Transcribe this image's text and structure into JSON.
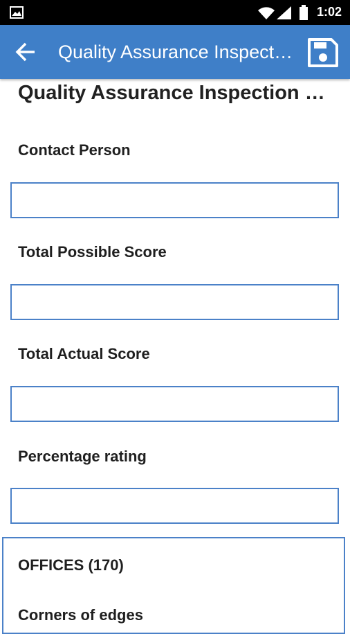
{
  "status_bar": {
    "time": "1:02",
    "icons": [
      "gallery-icon",
      "wifi-icon",
      "signal-icon",
      "battery-icon"
    ]
  },
  "app_bar": {
    "title": "Quality Assurance Inspection Report",
    "back_icon": "arrow-left-icon",
    "save_icon": "floppy-disk-icon",
    "color": "#3f7fc8"
  },
  "form": {
    "title": "Quality Assurance Inspection Report",
    "fields": [
      {
        "label": "Contact Person",
        "value": ""
      },
      {
        "label": "Total Possible Score",
        "value": ""
      },
      {
        "label": "Total Actual Score",
        "value": ""
      },
      {
        "label": "Percentage rating",
        "value": ""
      }
    ],
    "section": {
      "title": "OFFICES (170)",
      "items": [
        "Corners of edges"
      ]
    }
  },
  "colors": {
    "accent": "#3f7fc8",
    "input_border": "#4b81c8",
    "text": "#1f1f1f"
  }
}
